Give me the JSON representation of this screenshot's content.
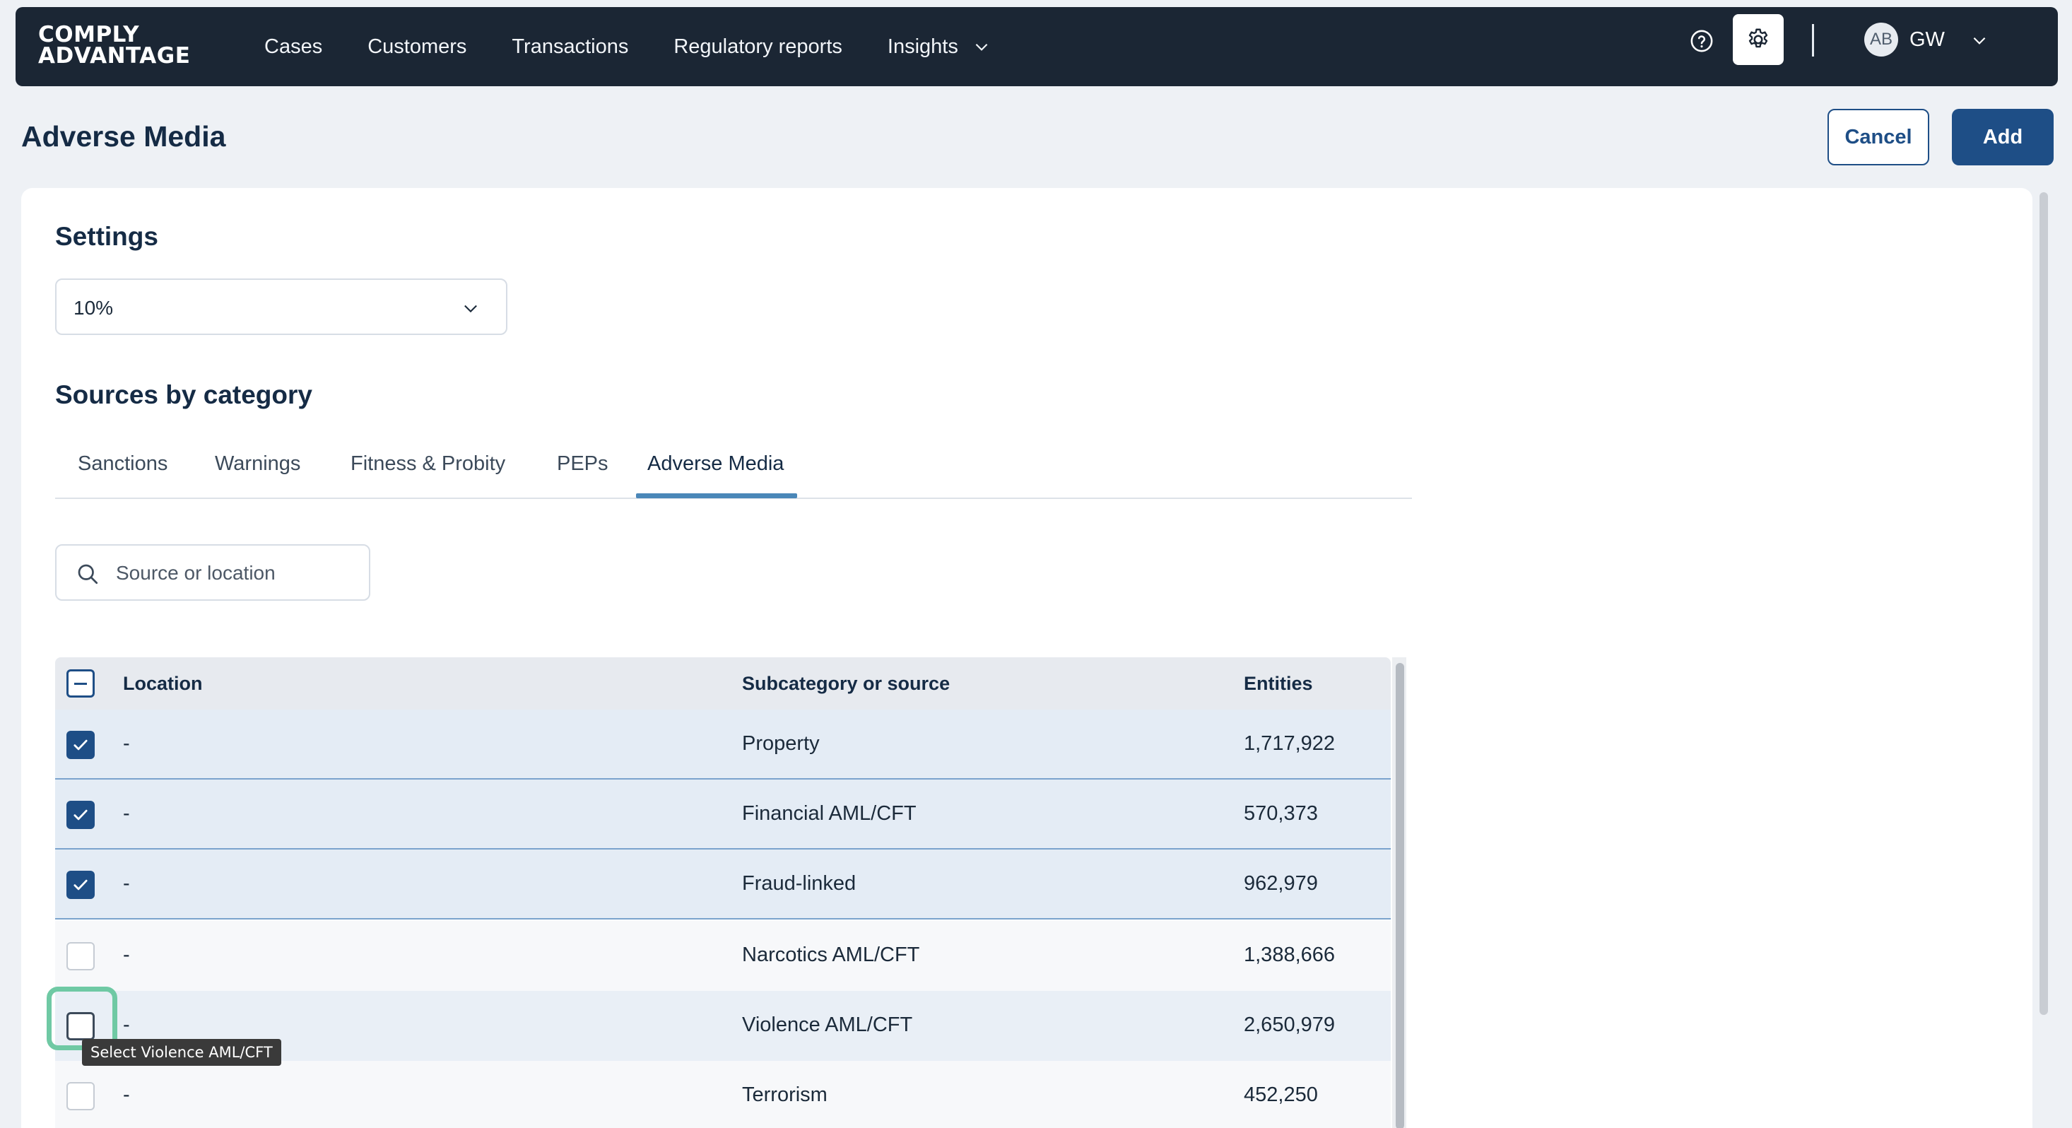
{
  "brand": {
    "logo_line1": "COMPLY",
    "logo_line2": "ADVANTAGE"
  },
  "nav": {
    "items": [
      {
        "label": "Cases"
      },
      {
        "label": "Customers"
      },
      {
        "label": "Transactions"
      },
      {
        "label": "Regulatory reports"
      },
      {
        "label": "Insights"
      }
    ],
    "help_icon": "help-circle-icon",
    "settings_icon": "gear-icon",
    "avatar_initials": "AB",
    "user_name": "GW"
  },
  "page": {
    "title": "Adverse Media",
    "cancel_label": "Cancel",
    "add_label": "Add"
  },
  "settings": {
    "heading": "Settings",
    "threshold_value": "10%"
  },
  "sources": {
    "heading": "Sources by category",
    "tabs": [
      {
        "label": "Sanctions"
      },
      {
        "label": "Warnings"
      },
      {
        "label": "Fitness & Probity"
      },
      {
        "label": "PEPs"
      },
      {
        "label": "Adverse Media"
      }
    ],
    "active_tab": "Adverse Media",
    "search_placeholder": "Source or location"
  },
  "table": {
    "columns": {
      "location": "Location",
      "subcategory": "Subcategory or source",
      "entities": "Entities"
    },
    "rows": [
      {
        "location": "-",
        "subcategory": "Property",
        "entities": "1,717,922",
        "checked": true
      },
      {
        "location": "-",
        "subcategory": "Financial AML/CFT",
        "entities": "570,373",
        "checked": true
      },
      {
        "location": "-",
        "subcategory": "Fraud-linked",
        "entities": "962,979",
        "checked": true
      },
      {
        "location": "-",
        "subcategory": "Narcotics AML/CFT",
        "entities": "1,388,666",
        "checked": false
      },
      {
        "location": "-",
        "subcategory": "Violence AML/CFT",
        "entities": "2,650,979",
        "checked": false
      },
      {
        "location": "-",
        "subcategory": "Terrorism",
        "entities": "452,250",
        "checked": false
      }
    ]
  },
  "tooltip": {
    "text": "Select Violence AML/CFT"
  },
  "colors": {
    "nav_bg": "#1b2634",
    "primary": "#1e4e86",
    "focus_ring": "#6fc9a4",
    "selected_row": "#e4ecf5"
  }
}
